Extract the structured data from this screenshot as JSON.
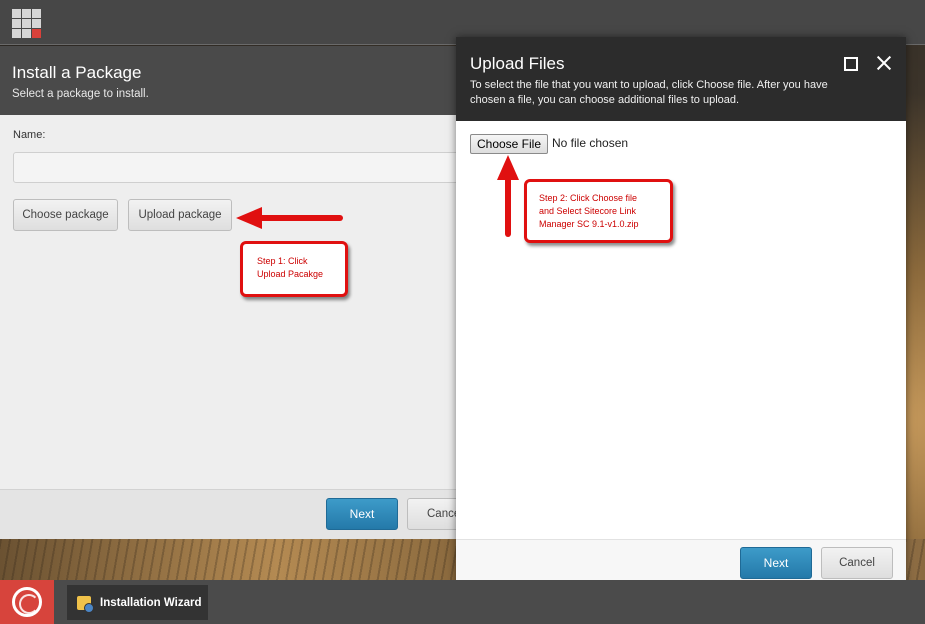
{
  "install_dialog": {
    "title": "Install a Package",
    "subtitle": "Select a package to install.",
    "name_label": "Name:",
    "name_value": "",
    "choose_package_label": "Choose package",
    "upload_package_label": "Upload package",
    "next_label": "Next",
    "cancel_label": "Cancel"
  },
  "upload_dialog": {
    "title": "Upload Files",
    "description": "To select the file that you want to upload, click Choose file. After you have chosen a file, you can choose additional files to upload.",
    "choose_file_label": "Choose File",
    "file_status": "No file chosen",
    "next_label": "Next",
    "cancel_label": "Cancel"
  },
  "annotations": {
    "step1_line1": "Step 1: Click",
    "step1_line2": "Upload Pacakge",
    "step2_line1": "Step 2: Click Choose file",
    "step2_line2": "and Select Sitecore Link",
    "step2_line3": "Manager SC 9.1-v1.0.zip"
  },
  "taskbar": {
    "task_label": "Installation Wizard"
  },
  "icons": {
    "app_launcher": "app-grid-icon",
    "maximize": "maximize-icon",
    "close": "close-icon",
    "start": "sitecore-logo-icon",
    "wizard": "installation-wizard-icon"
  },
  "colors": {
    "primary_button": "#2a86b8",
    "annotation_red": "#e01010",
    "brand_red": "#d7443c"
  }
}
